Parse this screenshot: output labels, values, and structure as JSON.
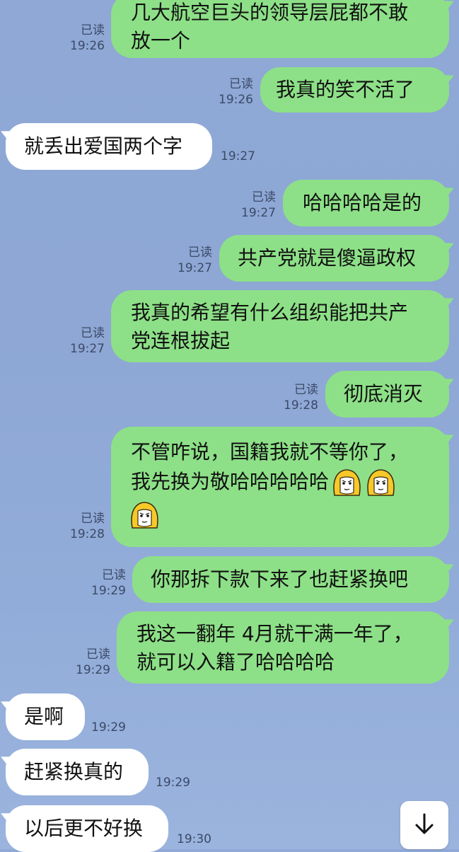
{
  "messages": [
    {
      "dir": "out",
      "lines": [
        "几大航空巨头的领导层屁都不敢",
        "放一个"
      ],
      "read": "已读",
      "time": "19:26"
    },
    {
      "dir": "out",
      "lines": [
        "我真的笑不活了"
      ],
      "read": "已读",
      "time": "19:26"
    },
    {
      "dir": "in",
      "lines": [
        "就丢出爱国两个字"
      ],
      "time": "19:27"
    },
    {
      "dir": "out",
      "lines": [
        "哈哈哈哈是的"
      ],
      "read": "已读",
      "time": "19:27"
    },
    {
      "dir": "out",
      "lines": [
        "共产党就是傻逼政权"
      ],
      "read": "已读",
      "time": "19:27"
    },
    {
      "dir": "out",
      "lines": [
        "我真的希望有什么组织能把共产",
        "党连根拔起"
      ],
      "read": "已读",
      "time": "19:27"
    },
    {
      "dir": "out",
      "lines": [
        "彻底消灭"
      ],
      "read": "已读",
      "time": "19:28"
    },
    {
      "dir": "out",
      "lines": [
        "不管咋说，国籍我就不等你了，",
        "我先换为敬哈哈哈哈哈"
      ],
      "stickers": 3,
      "read": "已读",
      "time": "19:28"
    },
    {
      "dir": "out",
      "lines": [
        "你那拆下款下来了也赶紧换吧"
      ],
      "read": "已读",
      "time": "19:29"
    },
    {
      "dir": "out",
      "lines": [
        "我这一翻年 4月就干满一年了，",
        "就可以入籍了哈哈哈哈"
      ],
      "read": "已读",
      "time": "19:29"
    },
    {
      "dir": "in",
      "lines": [
        "是啊"
      ],
      "time": "19:29"
    },
    {
      "dir": "in",
      "lines": [
        "赶紧换真的"
      ],
      "time": "19:29"
    },
    {
      "dir": "in",
      "lines": [
        "以后更不好换"
      ],
      "time": "19:30"
    }
  ],
  "icons": {
    "sticker": "blonde-face-sticker-icon",
    "scroll": "arrow-down-icon"
  },
  "colors": {
    "outgoing": "#8de087",
    "incoming": "#ffffff",
    "background": "#8fa8d6",
    "meta": "#3b4a66"
  }
}
